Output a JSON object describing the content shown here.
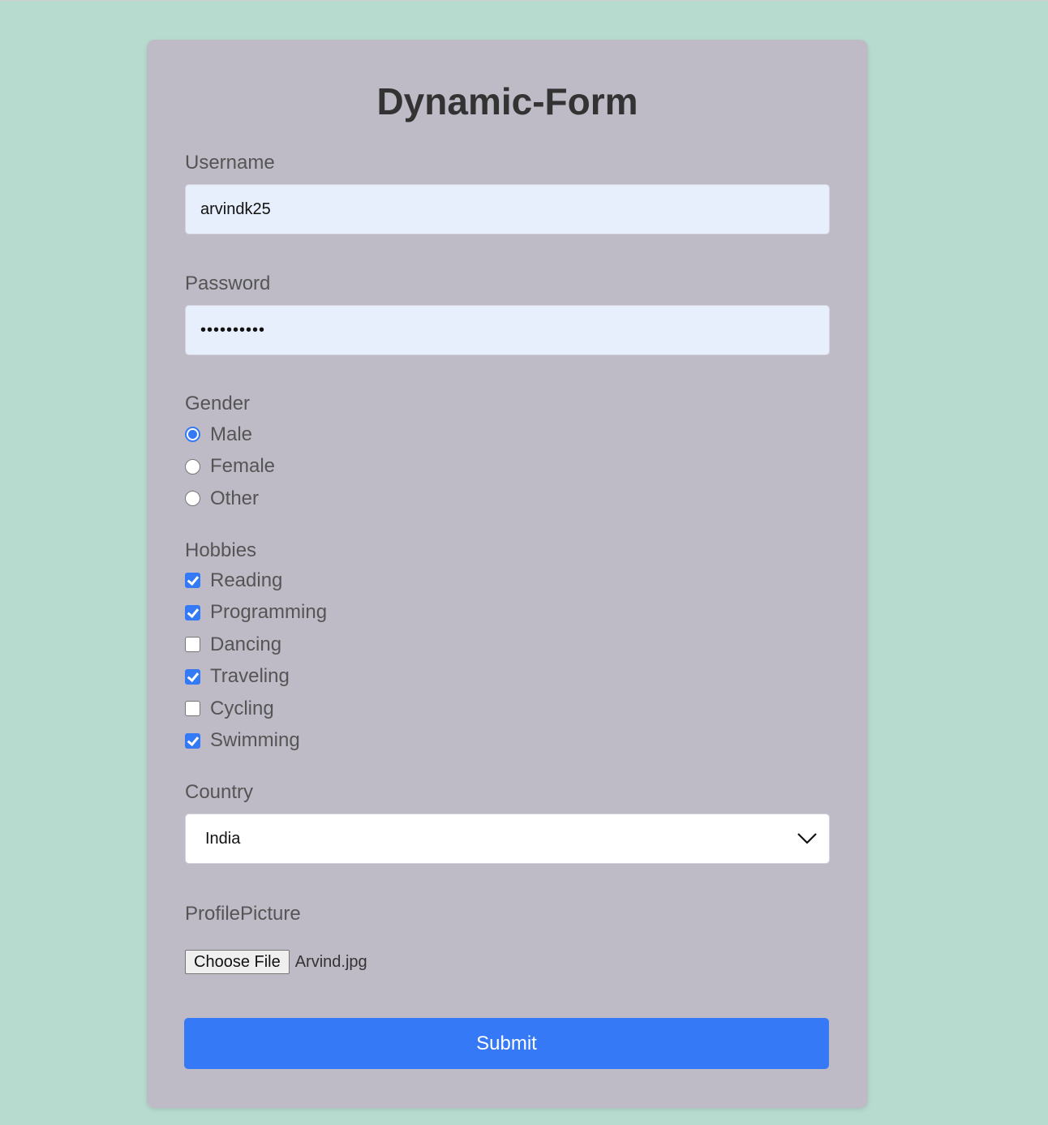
{
  "form": {
    "title": "Dynamic-Form",
    "username": {
      "label": "Username",
      "value": "arvindk25"
    },
    "password": {
      "label": "Password",
      "value": "••••••••••"
    },
    "gender": {
      "label": "Gender",
      "options": [
        {
          "label": "Male",
          "checked": true
        },
        {
          "label": "Female",
          "checked": false
        },
        {
          "label": "Other",
          "checked": false
        }
      ]
    },
    "hobbies": {
      "label": "Hobbies",
      "options": [
        {
          "label": "Reading",
          "checked": true
        },
        {
          "label": "Programming",
          "checked": true
        },
        {
          "label": "Dancing",
          "checked": false
        },
        {
          "label": "Traveling",
          "checked": true
        },
        {
          "label": "Cycling",
          "checked": false
        },
        {
          "label": "Swimming",
          "checked": true
        }
      ]
    },
    "country": {
      "label": "Country",
      "selected": "India",
      "icon": "chevron-down-icon"
    },
    "profile_picture": {
      "label": "ProfilePicture",
      "button_label": "Choose File",
      "file_name": "Arvind.jpg"
    },
    "submit_label": "Submit"
  },
  "colors": {
    "page_background": "#b8dbd0",
    "card_background": "#bebbc6",
    "accent": "#3679f6",
    "input_background": "#e8effc",
    "title_text": "#333333",
    "label_text": "#555555"
  }
}
